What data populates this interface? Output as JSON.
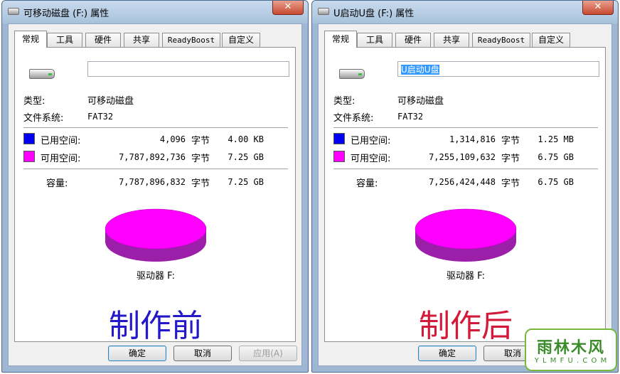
{
  "colors": {
    "used": "#0000ee",
    "free": "#ff00ff",
    "pie_top": "#ff00ff",
    "pie_side": "#9b1fa8",
    "caption_before": "#2418c8",
    "caption_after": "#d41a3a"
  },
  "windows": [
    {
      "title": "可移动磁盘 (F:) 属性",
      "close": "✕",
      "tabs": [
        "常规",
        "工具",
        "硬件",
        "共享",
        "ReadyBoost",
        "自定义"
      ],
      "name_value": "",
      "type_label": "类型:",
      "type_value": "可移动磁盘",
      "fs_label": "文件系统:",
      "fs_value": "FAT32",
      "used_label": "已用空间:",
      "used_bytes": "4,096",
      "used_unit": "字节",
      "used_size": "4.00 KB",
      "free_label": "可用空间:",
      "free_bytes": "7,787,892,736",
      "free_unit": "字节",
      "free_size": "7.25 GB",
      "cap_label": "容量:",
      "cap_bytes": "7,787,896,832",
      "cap_unit": "字节",
      "cap_size": "7.25 GB",
      "used_fraction": 5e-07,
      "drive_label": "驱动器 F:",
      "caption": "制作前",
      "buttons": {
        "ok": "确定",
        "cancel": "取消",
        "apply": "应用(A)"
      }
    },
    {
      "title": "U启动U盘 (F:) 属性",
      "close": "✕",
      "tabs": [
        "常规",
        "工具",
        "硬件",
        "共享",
        "ReadyBoost",
        "自定义"
      ],
      "name_value": "U启动U盘",
      "type_label": "类型:",
      "type_value": "可移动磁盘",
      "fs_label": "文件系统:",
      "fs_value": "FAT32",
      "used_label": "已用空间:",
      "used_bytes": "1,314,816",
      "used_unit": "字节",
      "used_size": "1.25 MB",
      "free_label": "可用空间:",
      "free_bytes": "7,255,109,632",
      "free_unit": "字节",
      "free_size": "6.75 GB",
      "cap_label": "容量:",
      "cap_bytes": "7,256,424,448",
      "cap_unit": "字节",
      "cap_size": "6.75 GB",
      "used_fraction": 0.00018,
      "drive_label": "驱动器 F:",
      "caption": "制作后",
      "buttons": {
        "ok": "确定",
        "cancel": "取消"
      }
    }
  ],
  "watermark": {
    "text": "雨林木风",
    "sub": "Y L M F U . C O M"
  }
}
